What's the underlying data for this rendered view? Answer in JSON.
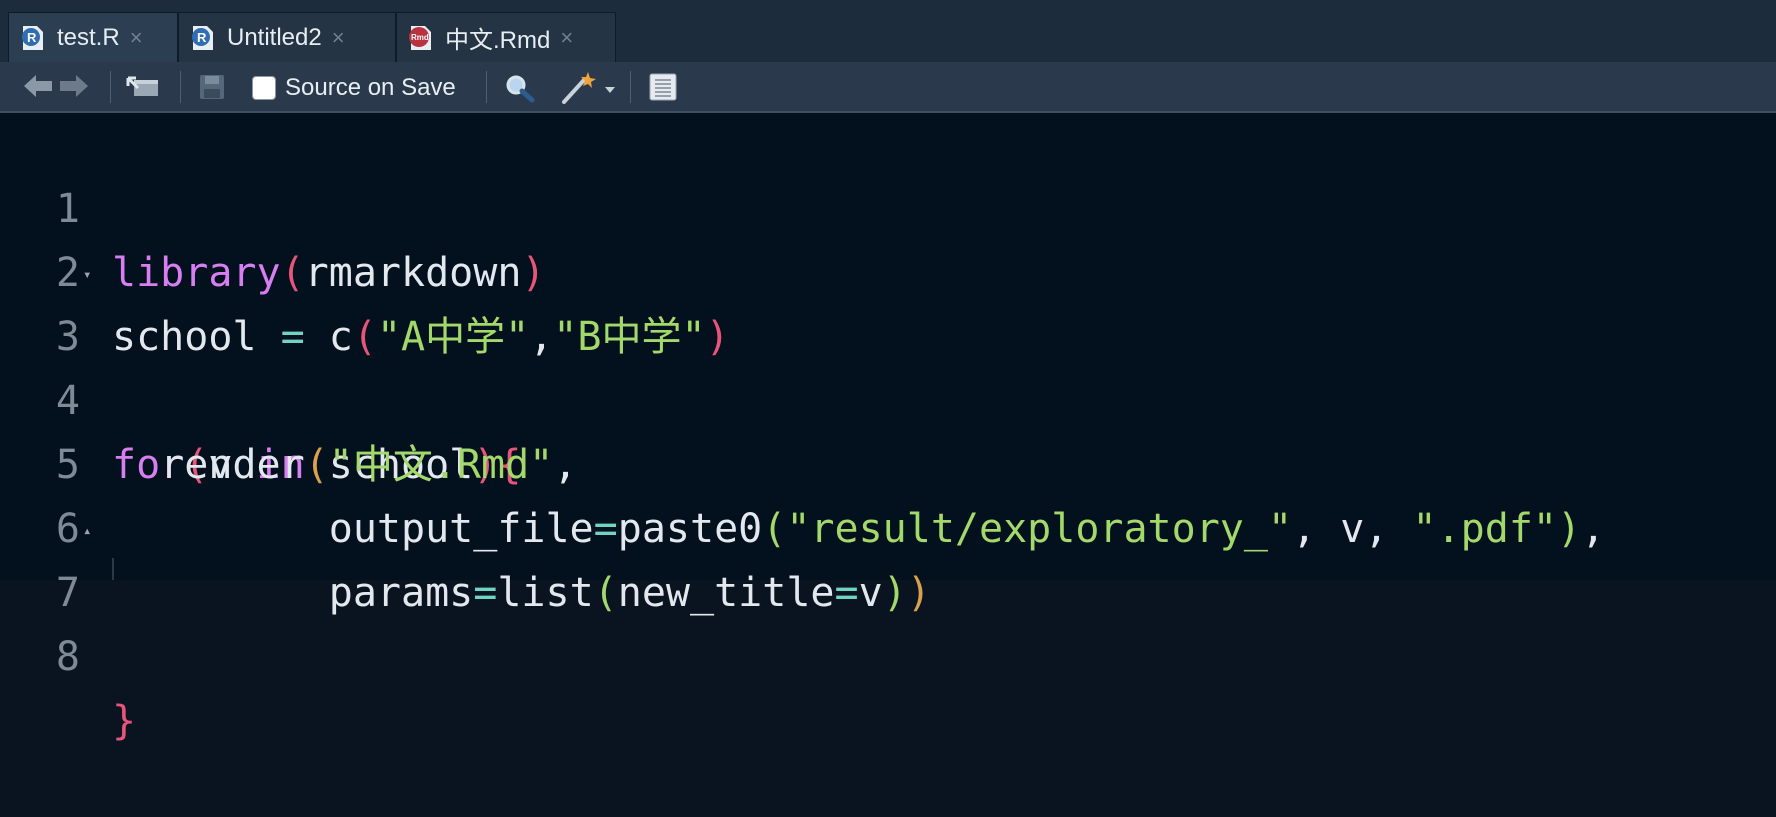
{
  "tabs": [
    {
      "label": "test.R",
      "icon": "r-file-icon",
      "active": true
    },
    {
      "label": "Untitled2",
      "icon": "r-file-icon",
      "active": false
    },
    {
      "label": "中文.Rmd",
      "icon": "rmd-file-icon",
      "active": false
    }
  ],
  "toolbar": {
    "source_on_save_label": "Source on Save",
    "source_on_save_checked": false
  },
  "gutter": [
    "1",
    "2",
    "3",
    "4",
    "5",
    "6",
    "7",
    "8"
  ],
  "code_tokens": {
    "l1": [
      "library",
      "(",
      "rmarkdown",
      ")"
    ],
    "l2": [
      "school ",
      "=",
      " c",
      "(",
      "\"A中学\"",
      ",",
      "\"B中学\"",
      ")"
    ],
    "l3": [
      "for",
      "(",
      "v ",
      "in",
      " school",
      ")",
      "{"
    ],
    "l4": [
      "  render",
      "(",
      "\"中文.Rmd\"",
      ","
    ],
    "l5": [
      "         output_file",
      "=",
      "paste0",
      "(",
      "\"result/exploratory_\"",
      ", v, ",
      "\".pdf\"",
      ")",
      ","
    ],
    "l6": [
      "         params",
      "=",
      "list",
      "(",
      "new_title",
      "=",
      "v",
      ")",
      ")"
    ],
    "l7": [
      "}"
    ]
  },
  "colors": {
    "keyword": "#d77ef0",
    "string": "#a2d96a",
    "operator": "#6fd4c3",
    "paren_level1": "#e8557a",
    "paren_level2": "#d9a04d",
    "paren_level3": "#a2d96a",
    "background": "#03101e"
  }
}
